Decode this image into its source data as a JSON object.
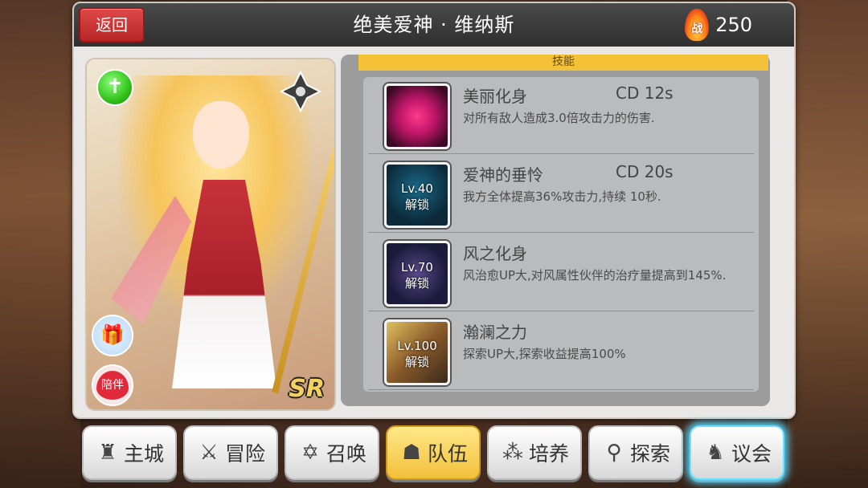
{
  "header": {
    "back_label": "返回",
    "title": "绝美爱神 · 维纳斯",
    "power_badge": "战",
    "power_value": "250"
  },
  "character": {
    "rarity": "SR",
    "accompany_label": "陪伴"
  },
  "skills": {
    "tab_label": "技能",
    "items": [
      {
        "name": "美丽化身",
        "cd": "CD  12s",
        "desc": "对所有敌人造成3.0倍攻击力的伤害.",
        "lock": ""
      },
      {
        "name": "爱神的垂怜",
        "cd": "CD  20s",
        "desc": "我方全体提高36%攻击力,持续 10秒.",
        "lock_level": "Lv.40",
        "lock_text": "解锁"
      },
      {
        "name": "风之化身",
        "cd": "",
        "desc": "风治愈UP大,对风属性伙伴的治疗量提高到145%.",
        "lock_level": "Lv.70",
        "lock_text": "解锁"
      },
      {
        "name": "瀚澜之力",
        "cd": "",
        "desc": "探索UP大,探索收益提高100%",
        "lock_level": "Lv.100",
        "lock_text": "解锁"
      }
    ]
  },
  "nav": {
    "items": [
      {
        "label": "主城",
        "icon": "castle-icon"
      },
      {
        "label": "冒险",
        "icon": "crossed-swords-icon"
      },
      {
        "label": "召唤",
        "icon": "summon-circle-icon"
      },
      {
        "label": "队伍",
        "icon": "team-icon"
      },
      {
        "label": "培养",
        "icon": "cultivate-icon"
      },
      {
        "label": "探索",
        "icon": "explore-icon"
      },
      {
        "label": "议会",
        "icon": "council-icon"
      }
    ],
    "active": "队伍"
  }
}
